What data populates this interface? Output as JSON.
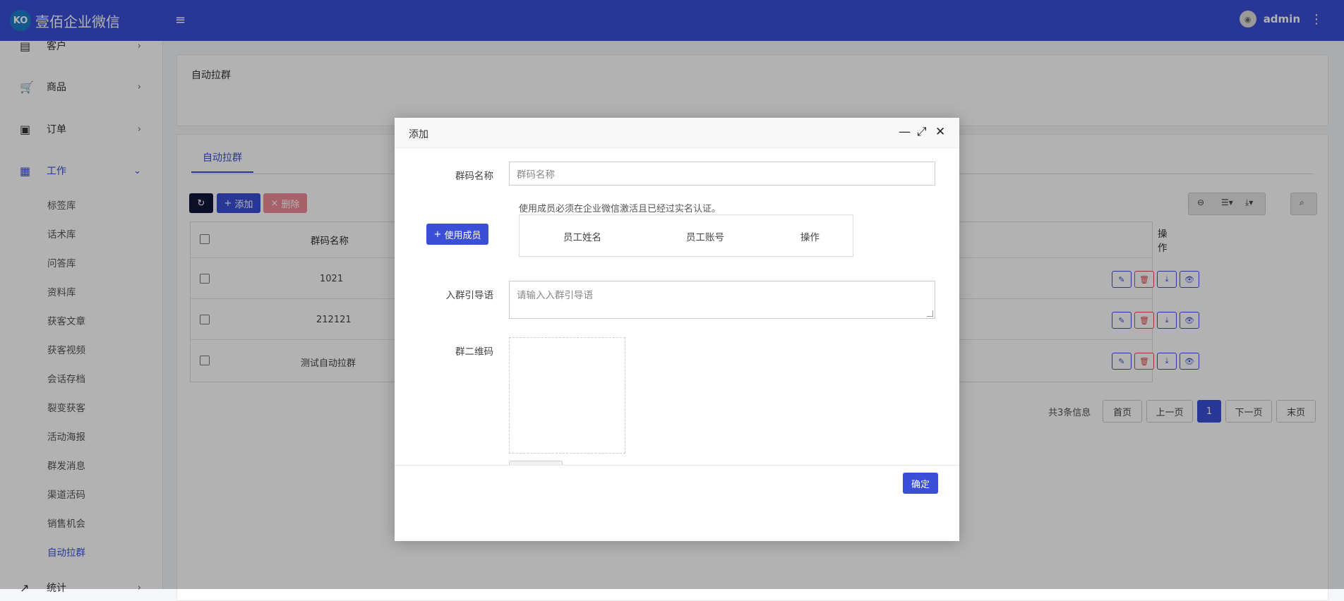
{
  "header": {
    "logo_text": "壹佰企业微信",
    "logo_mark": "KO",
    "username": "admin"
  },
  "sidebar": {
    "top_items": [
      {
        "label": "客户",
        "icon": "contact-card-icon"
      },
      {
        "label": "商品",
        "icon": "cart-icon"
      },
      {
        "label": "订单",
        "icon": "money-icon"
      },
      {
        "label": "工作",
        "icon": "grid-icon"
      },
      {
        "label": "统计",
        "icon": "chart-icon"
      }
    ],
    "sub_items": [
      "标签库",
      "话术库",
      "问答库",
      "资料库",
      "获客文章",
      "获客视频",
      "会话存档",
      "裂变获客",
      "活动海报",
      "群发消息",
      "渠道活码",
      "销售机会",
      "自动拉群"
    ]
  },
  "page": {
    "title": "自动拉群",
    "tab": "自动拉群",
    "toolbar": {
      "add_label": "添加",
      "delete_label": "删除"
    },
    "table": {
      "headers": {
        "name": "群码名称",
        "actions": "操作"
      },
      "rows": [
        {
          "name": "1021"
        },
        {
          "name": "212121"
        },
        {
          "name": "测试自动拉群"
        }
      ]
    },
    "pager": {
      "summary": "共3条信息",
      "first": "首页",
      "prev": "上一页",
      "current": "1",
      "next": "下一页",
      "last": "末页"
    }
  },
  "modal": {
    "title": "添加",
    "fields": {
      "name_label": "群码名称",
      "name_placeholder": "群码名称",
      "hint": "使用成员必须在企业微信激活且已经过实名认证。",
      "member_button": "使用成员",
      "member_headers": [
        "员工姓名",
        "员工账号",
        "操作"
      ],
      "guide_label": "入群引导语",
      "guide_placeholder": "请输入入群引导语",
      "qr_label": "群二维码"
    },
    "confirm_label": "确定"
  },
  "colors": {
    "primary": "#3a4fd6",
    "danger": "#e24a4a",
    "sidebar_bg": "#ffffff"
  }
}
